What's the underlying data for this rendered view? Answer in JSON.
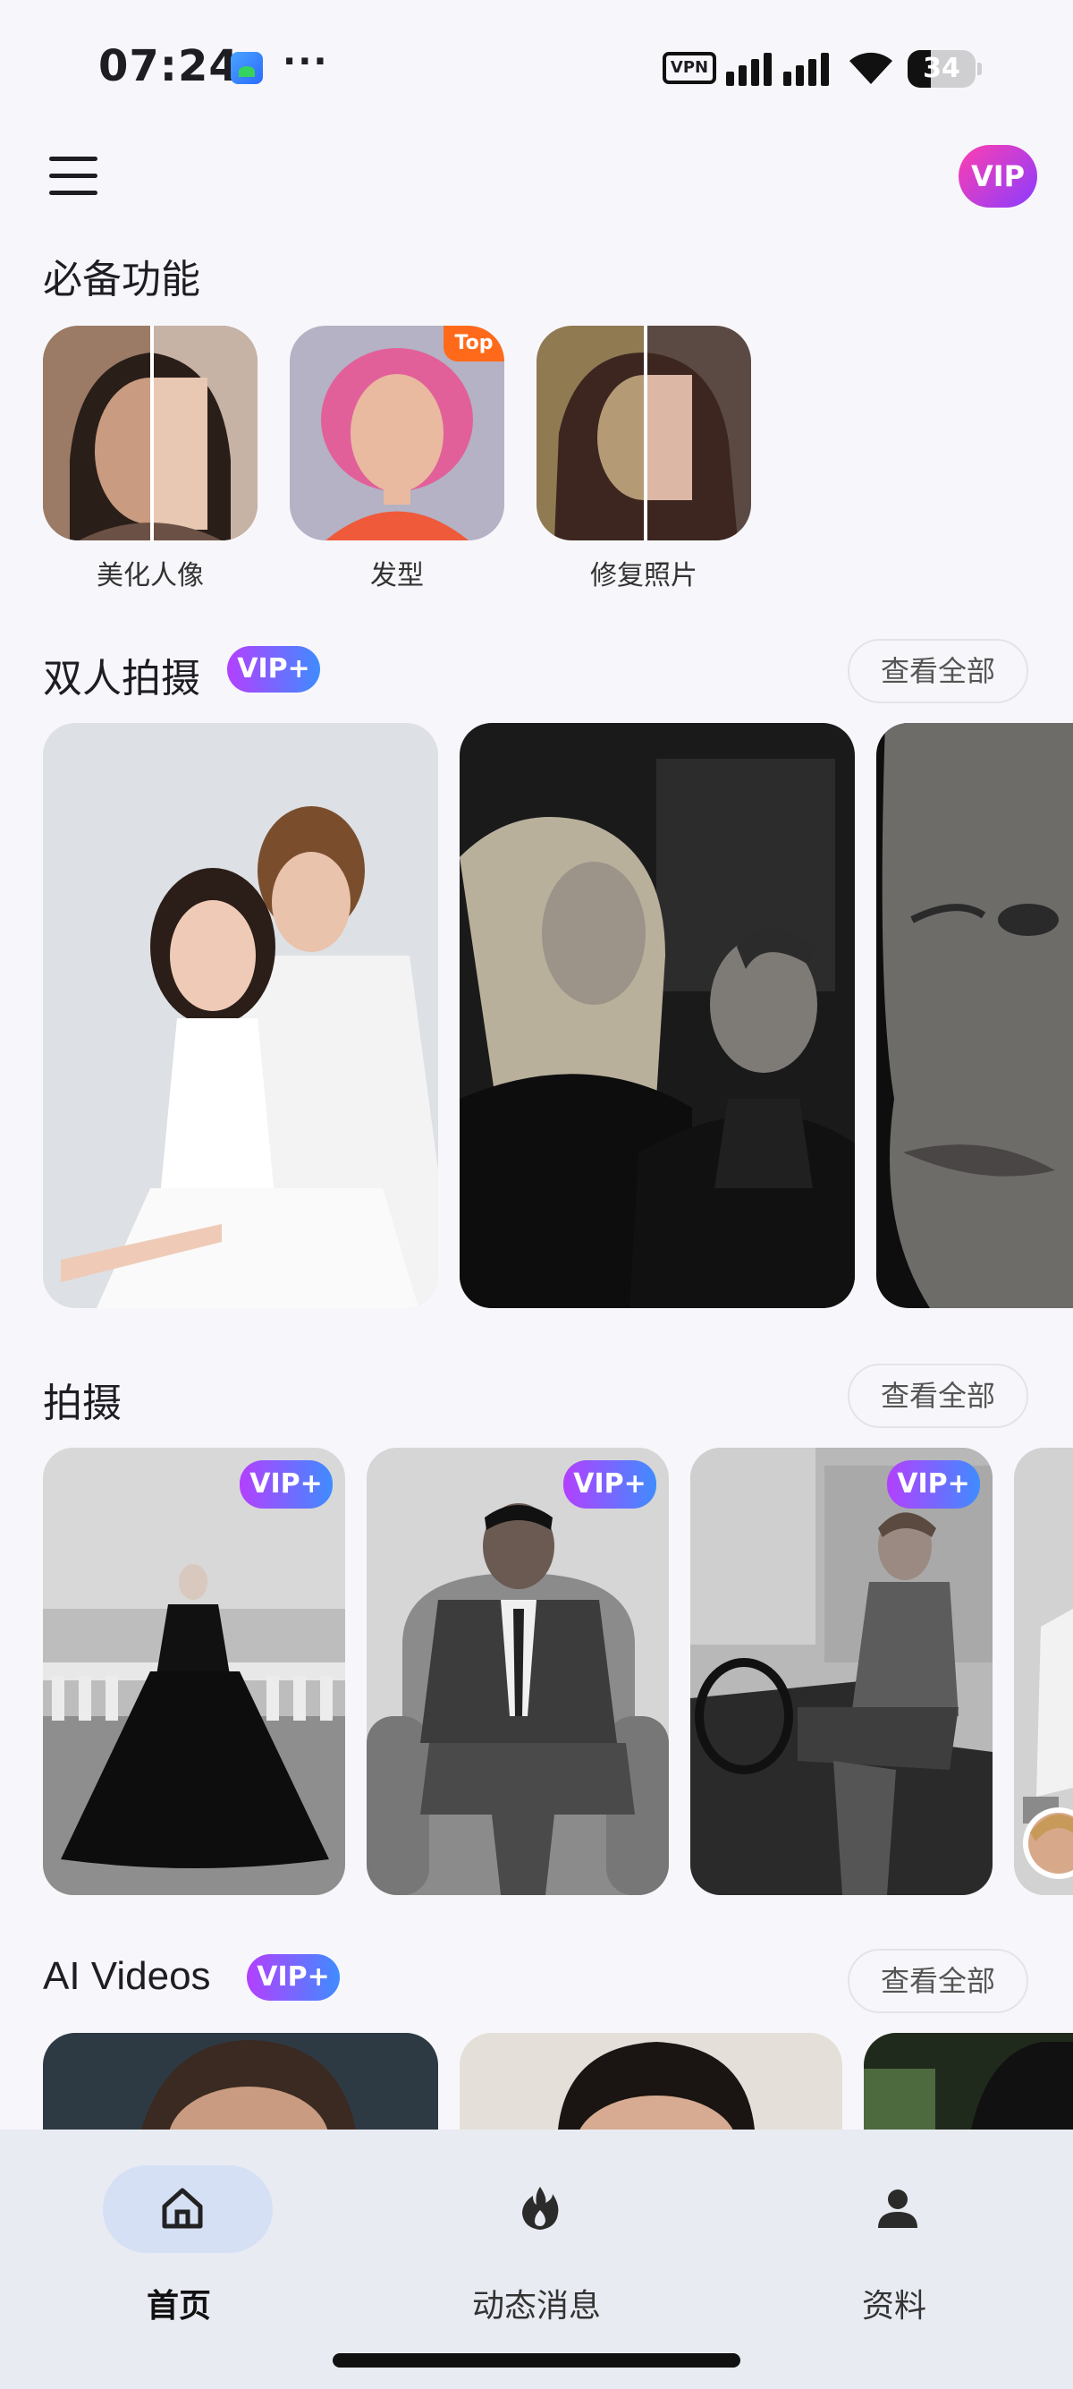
{
  "status_bar": {
    "time": "07:24",
    "dots": "···",
    "vpn": "VPN",
    "battery": "34",
    "battery_level": 0.34
  },
  "header": {
    "menu_icon": "hamburger-menu-icon",
    "vip": "VIP"
  },
  "essentials": {
    "title": "必备功能",
    "items": [
      {
        "label": "美化人像"
      },
      {
        "label": "发型",
        "tag": "Top"
      },
      {
        "label": "修复照片"
      }
    ]
  },
  "couple": {
    "title": "双人拍摄",
    "badge": "VIP+",
    "see_all": "查看全部"
  },
  "shoot": {
    "title": "拍摄",
    "see_all": "查看全部",
    "badge": "VIP+"
  },
  "ai_videos": {
    "title": "AI Videos",
    "badge": "VIP+",
    "see_all": "查看全部"
  },
  "bottom_nav": {
    "items": [
      {
        "label": "首页",
        "icon": "home-icon",
        "active": true
      },
      {
        "label": "动态消息",
        "icon": "flame-icon",
        "active": false
      },
      {
        "label": "资料",
        "icon": "person-icon",
        "active": false
      }
    ]
  },
  "colors": {
    "vip_gradient": [
      "#ff3fb0",
      "#8a3cff"
    ],
    "vip_plus_gradient": [
      "#b340ff",
      "#3f8cff"
    ],
    "top_tag": "#ff6a1a",
    "nav_active": "#d6e0f4"
  }
}
